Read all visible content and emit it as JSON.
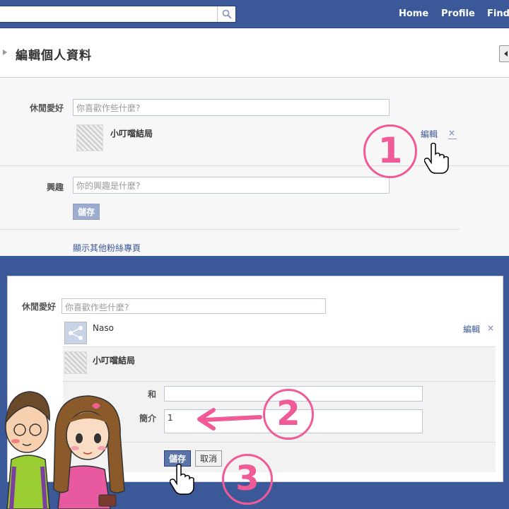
{
  "topbar": {
    "search_placeholder": "",
    "nav": [
      "Home",
      "Profile",
      "Find"
    ]
  },
  "upper": {
    "page_title": "編輯個人資料",
    "hobbies_label": "休閒愛好",
    "hobbies_placeholder": "你喜歡作些什麼?",
    "hobby_item": "小叮噹結局",
    "edit_link": "編輯",
    "remove_icon": "×",
    "interests_label": "興趣",
    "interests_placeholder": "你的興趣是什麼?",
    "save_button": "儲存",
    "show_other_pages": "顯示其他粉絲專頁"
  },
  "lower": {
    "hobbies_label": "休閒愛好",
    "hobbies_placeholder": "你喜歡作些什麼?",
    "naso_item": "Naso",
    "edit_link": "編輯",
    "remove_icon": "×",
    "hobby_item": "小叮噹結局",
    "with_label": "和",
    "with_value": "",
    "intro_label": "簡介",
    "intro_value": "1",
    "save_button": "儲存",
    "cancel_button": "取消"
  },
  "annotations": {
    "step1": "1",
    "step2": "2",
    "step3": "3"
  },
  "colors": {
    "facebook_blue": "#3b5998",
    "annotation_pink": "#f05a96"
  }
}
